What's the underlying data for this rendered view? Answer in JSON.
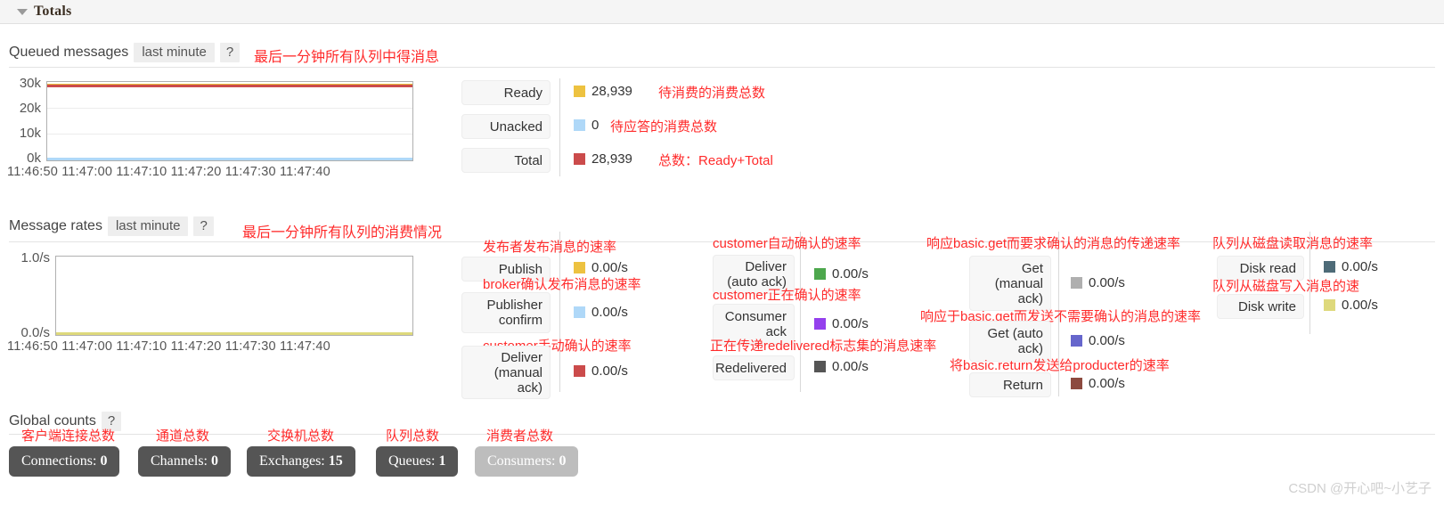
{
  "panel": {
    "title": "Totals",
    "collapse_icon": "caret-down-icon"
  },
  "queued_messages": {
    "label": "Queued messages",
    "period": "last minute",
    "help": "?",
    "annotation": "最后一分钟所有队列中得消息",
    "chart": {
      "y_ticks": [
        "30k",
        "20k",
        "10k",
        "0k"
      ],
      "x_ticks": "11:46:50 11:47:00 11:47:10 11:47:20 11:47:30 11:47:40"
    },
    "legend": [
      {
        "label": "Ready",
        "value": "28,939",
        "color": "#edc240",
        "annotation": "待消费的消费总数"
      },
      {
        "label": "Unacked",
        "value": "0",
        "color": "#afd8f8",
        "annotation": "待应答的消费总数"
      },
      {
        "label": "Total",
        "value": "28,939",
        "color": "#cb4b4b",
        "annotation": "总数：Ready+Total"
      }
    ]
  },
  "message_rates": {
    "label": "Message rates",
    "period": "last minute",
    "help": "?",
    "annotation": "最后一分钟所有队列的消费情况",
    "chart": {
      "y_ticks": [
        "1.0/s",
        "0.0/s"
      ],
      "x_ticks": "11:46:50 11:47:00 11:47:10 11:47:20 11:47:30 11:47:40"
    },
    "columns": [
      {
        "rows": [
          {
            "label": "Publish",
            "value": "0.00/s",
            "color": "#edc240",
            "annotation": "发布者发布消息的速率"
          },
          {
            "label": "Publisher\nconfirm",
            "value": "0.00/s",
            "color": "#afd8f8",
            "annotation": "broker确认发布消息的速率"
          },
          {
            "label": "Deliver\n(manual\nack)",
            "value": "0.00/s",
            "color": "#cb4b4b",
            "annotation": "customer手动确认的速率"
          }
        ]
      },
      {
        "rows": [
          {
            "label": "Deliver\n(auto ack)",
            "value": "0.00/s",
            "color": "#4da74d",
            "annotation": "customer自动确认的速率"
          },
          {
            "label": "Consumer\nack",
            "value": "0.00/s",
            "color": "#9440ed",
            "annotation": "customer正在确认的速率"
          },
          {
            "label": "Redelivered",
            "value": "0.00/s",
            "color": "#555555",
            "annotation": "正在传递redelivered标志集的消息速率"
          }
        ]
      },
      {
        "rows": [
          {
            "label": "Get\n(manual\nack)",
            "value": "0.00/s",
            "color": "#afafaf",
            "annotation": "响应basic.get而要求确认的消息的传递速率"
          },
          {
            "label": "Get (auto\nack)",
            "value": "0.00/s",
            "color": "#6666cc",
            "annotation": "响应于basic.get而发送不需要确认的消息的速率"
          },
          {
            "label": "Return",
            "value": "0.00/s",
            "color": "#8c4a3f",
            "annotation": "将basic.return发送给producter的速率"
          }
        ]
      },
      {
        "rows": [
          {
            "label": "Disk read",
            "value": "0.00/s",
            "color": "#4e6b78",
            "annotation": "队列从磁盘读取消息的速率"
          },
          {
            "label": "Disk write",
            "value": "0.00/s",
            "color": "#ded97c",
            "annotation": "队列从磁盘写入消息的速"
          }
        ]
      }
    ]
  },
  "global_counts": {
    "label": "Global counts",
    "help": "?",
    "items": [
      {
        "label": "Connections:",
        "value": "0",
        "annotation": "客户端连接总数",
        "muted": false
      },
      {
        "label": "Channels:",
        "value": "0",
        "annotation": "通道总数",
        "muted": false
      },
      {
        "label": "Exchanges:",
        "value": "15",
        "annotation": "交换机总数",
        "muted": false
      },
      {
        "label": "Queues:",
        "value": "1",
        "annotation": "队列总数",
        "muted": false
      },
      {
        "label": "Consumers:",
        "value": "0",
        "annotation": "消费者总数",
        "muted": true
      }
    ]
  },
  "watermark": "CSDN @开心吧~小艺子",
  "chart_data": [
    {
      "type": "line",
      "title": "Queued messages",
      "xlabel": "",
      "ylabel": "",
      "ylim": [
        0,
        30000
      ],
      "y_ticks": [
        0,
        10000,
        20000,
        30000
      ],
      "y_ticklabels": [
        "0k",
        "10k",
        "20k",
        "30k"
      ],
      "x": [
        "11:46:50",
        "11:47:00",
        "11:47:10",
        "11:47:20",
        "11:47:30",
        "11:47:40"
      ],
      "grid": true,
      "legend_position": "right",
      "series": [
        {
          "name": "Ready",
          "color": "#edc240",
          "values": [
            28939,
            28939,
            28939,
            28939,
            28939,
            28939
          ]
        },
        {
          "name": "Unacked",
          "color": "#afd8f8",
          "values": [
            0,
            0,
            0,
            0,
            0,
            0
          ]
        },
        {
          "name": "Total",
          "color": "#cb4b4b",
          "values": [
            28939,
            28939,
            28939,
            28939,
            28939,
            28939
          ]
        }
      ]
    },
    {
      "type": "line",
      "title": "Message rates",
      "xlabel": "",
      "ylabel": "",
      "ylim": [
        0,
        1.0
      ],
      "y_ticks": [
        0,
        1.0
      ],
      "y_ticklabels": [
        "0.0/s",
        "1.0/s"
      ],
      "x": [
        "11:46:50",
        "11:47:00",
        "11:47:10",
        "11:47:20",
        "11:47:30",
        "11:47:40"
      ],
      "grid": false,
      "legend_position": "right",
      "series": [
        {
          "name": "Publish",
          "color": "#edc240",
          "values": [
            0,
            0,
            0,
            0,
            0,
            0
          ]
        },
        {
          "name": "Publisher confirm",
          "color": "#afd8f8",
          "values": [
            0,
            0,
            0,
            0,
            0,
            0
          ]
        },
        {
          "name": "Deliver (manual ack)",
          "color": "#cb4b4b",
          "values": [
            0,
            0,
            0,
            0,
            0,
            0
          ]
        },
        {
          "name": "Deliver (auto ack)",
          "color": "#4da74d",
          "values": [
            0,
            0,
            0,
            0,
            0,
            0
          ]
        },
        {
          "name": "Consumer ack",
          "color": "#9440ed",
          "values": [
            0,
            0,
            0,
            0,
            0,
            0
          ]
        },
        {
          "name": "Redelivered",
          "color": "#555555",
          "values": [
            0,
            0,
            0,
            0,
            0,
            0
          ]
        },
        {
          "name": "Get (manual ack)",
          "color": "#afafaf",
          "values": [
            0,
            0,
            0,
            0,
            0,
            0
          ]
        },
        {
          "name": "Get (auto ack)",
          "color": "#6666cc",
          "values": [
            0,
            0,
            0,
            0,
            0,
            0
          ]
        },
        {
          "name": "Return",
          "color": "#8c4a3f",
          "values": [
            0,
            0,
            0,
            0,
            0,
            0
          ]
        },
        {
          "name": "Disk read",
          "color": "#4e6b78",
          "values": [
            0,
            0,
            0,
            0,
            0,
            0
          ]
        },
        {
          "name": "Disk write",
          "color": "#ded97c",
          "values": [
            0,
            0,
            0,
            0,
            0,
            0
          ]
        }
      ]
    }
  ]
}
